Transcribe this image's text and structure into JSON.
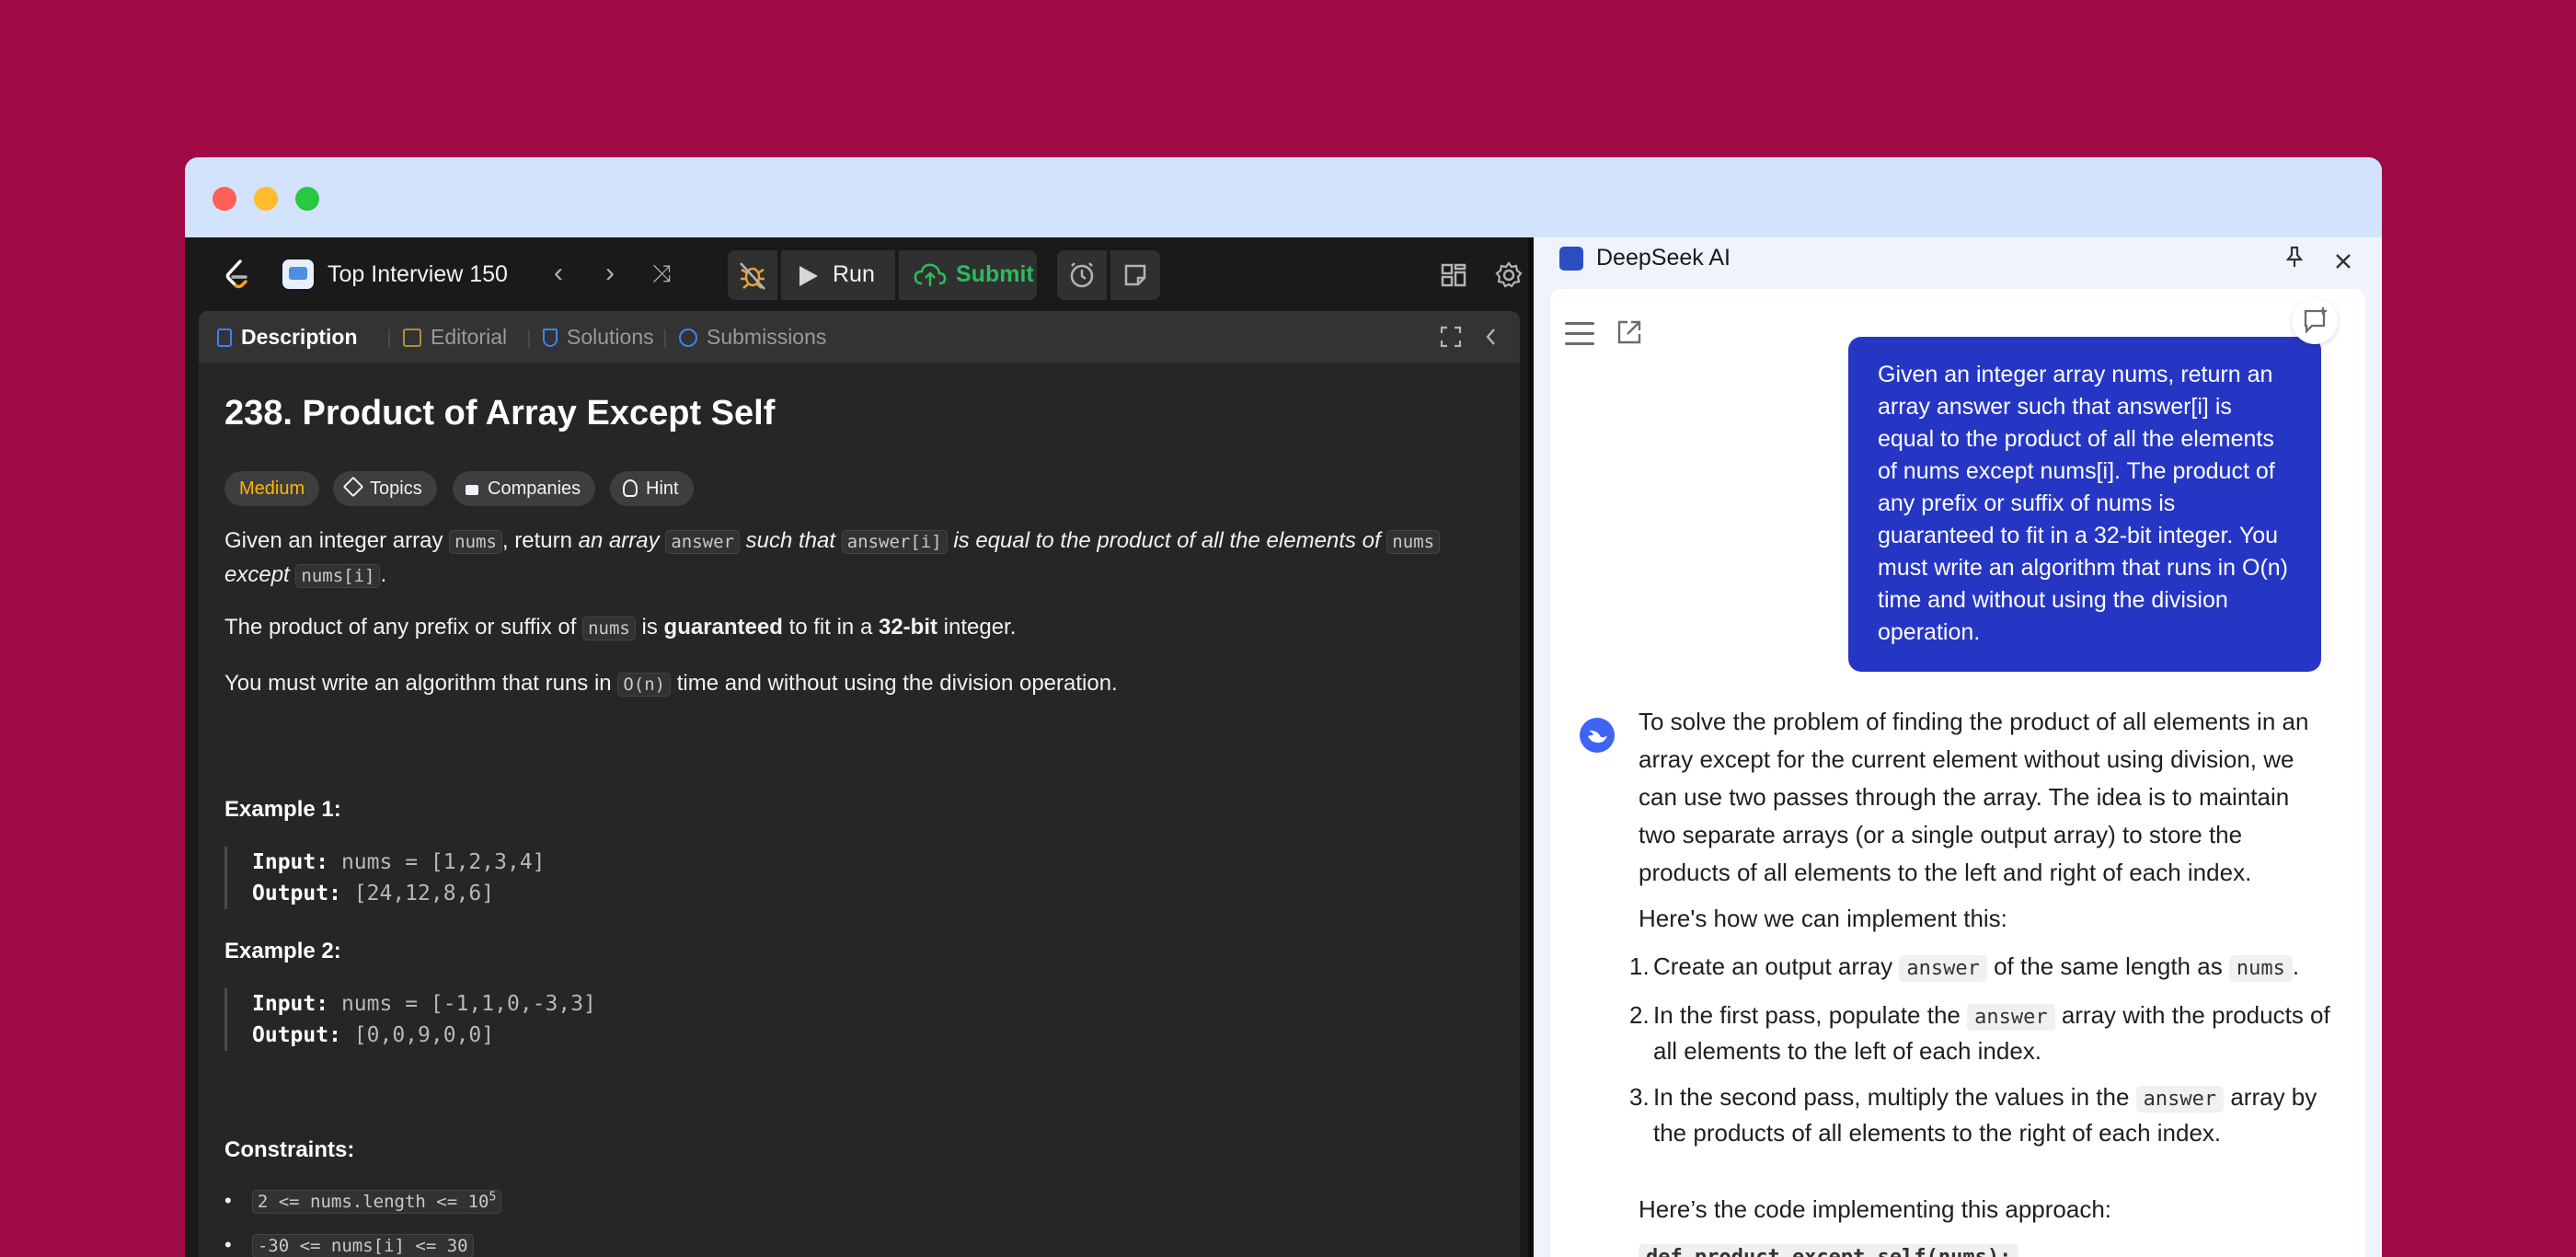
{
  "leetcode": {
    "list_title": "Top Interview 150",
    "nav": {
      "prev": "‹",
      "next": "›",
      "shuffle": "⤨"
    },
    "toolbar": {
      "run_label": "Run",
      "submit_label": "Submit"
    },
    "tabs": [
      {
        "label": "Description"
      },
      {
        "label": "Editorial"
      },
      {
        "label": "Solutions"
      },
      {
        "label": "Submissions"
      }
    ],
    "problem": {
      "title": "238. Product of Array Except Self",
      "tags": [
        "Medium",
        "Topics",
        "Companies",
        "Hint"
      ],
      "desc1": {
        "t1": "Given an integer array ",
        "c1": "nums",
        "t2": ", return ",
        "i1": "an array",
        "c2": "answer",
        "i2": "such that",
        "c3": "answer[i]",
        "i3": "is equal to the product of all the elements of",
        "c4": "nums",
        "i4": "except",
        "c5": "nums[i]",
        "t3": "."
      },
      "desc2": {
        "t1": "The product of any prefix or suffix of ",
        "c1": "nums",
        "t2": " is ",
        "b1": "guaranteed",
        "t3": " to fit in a ",
        "b2": "32-bit",
        "t4": " integer."
      },
      "desc3": {
        "t1": "You must write an algorithm that runs in ",
        "c1": "O(n)",
        "t2": " time and without using the division operation."
      },
      "example1": {
        "heading": "Example 1:",
        "input_label": "Input:",
        "input": "nums = [1,2,3,4]",
        "output_label": "Output:",
        "output": "[24,12,8,6]"
      },
      "example2": {
        "heading": "Example 2:",
        "input_label": "Input:",
        "input": "nums = [-1,1,0,-3,3]",
        "output_label": "Output:",
        "output": "[0,0,9,0,0]"
      },
      "constraints_heading": "Constraints:",
      "constraints": [
        {
          "text": "2 <= nums.length <= 10",
          "sup": "5"
        },
        {
          "text": "-30 <= nums[i] <= 30",
          "sup": ""
        }
      ]
    }
  },
  "deepseek": {
    "title": "DeepSeek AI",
    "user_message": "Given an integer array nums, return an array answer such that answer[i] is equal to the product of all the elements of nums except nums[i]. The product of any prefix or suffix of nums is guaranteed to fit in a 32-bit integer. You must write an algorithm that runs in O(n) time and without using the division operation.",
    "reply_intro": "To solve the problem of finding the product of all elements in an array except for the current element without using division, we can use two passes through the array. The idea is to maintain two separate arrays (or a single output array) to store the products of all elements to the left and right of each index.",
    "reply_howto": "Here's how we can implement this:",
    "steps": [
      {
        "num": "1.",
        "t1": "Create an output array ",
        "c": "answer",
        "t2": " of the same length as ",
        "c2": "nums",
        "t3": "."
      },
      {
        "num": "2.",
        "t1": "In the first pass, populate the ",
        "c": "answer",
        "t2": " array with the products of all elements to the left of each index.",
        "c2": "",
        "t3": ""
      },
      {
        "num": "3.",
        "t1": "In the second pass, multiply the values in the ",
        "c": "answer",
        "t2": " array by the products of all elements to the right of each index.",
        "c2": "",
        "t3": ""
      }
    ],
    "code_intro": "Here’s the code implementing this approach:",
    "code_line": "def product_except_self(nums):"
  }
}
